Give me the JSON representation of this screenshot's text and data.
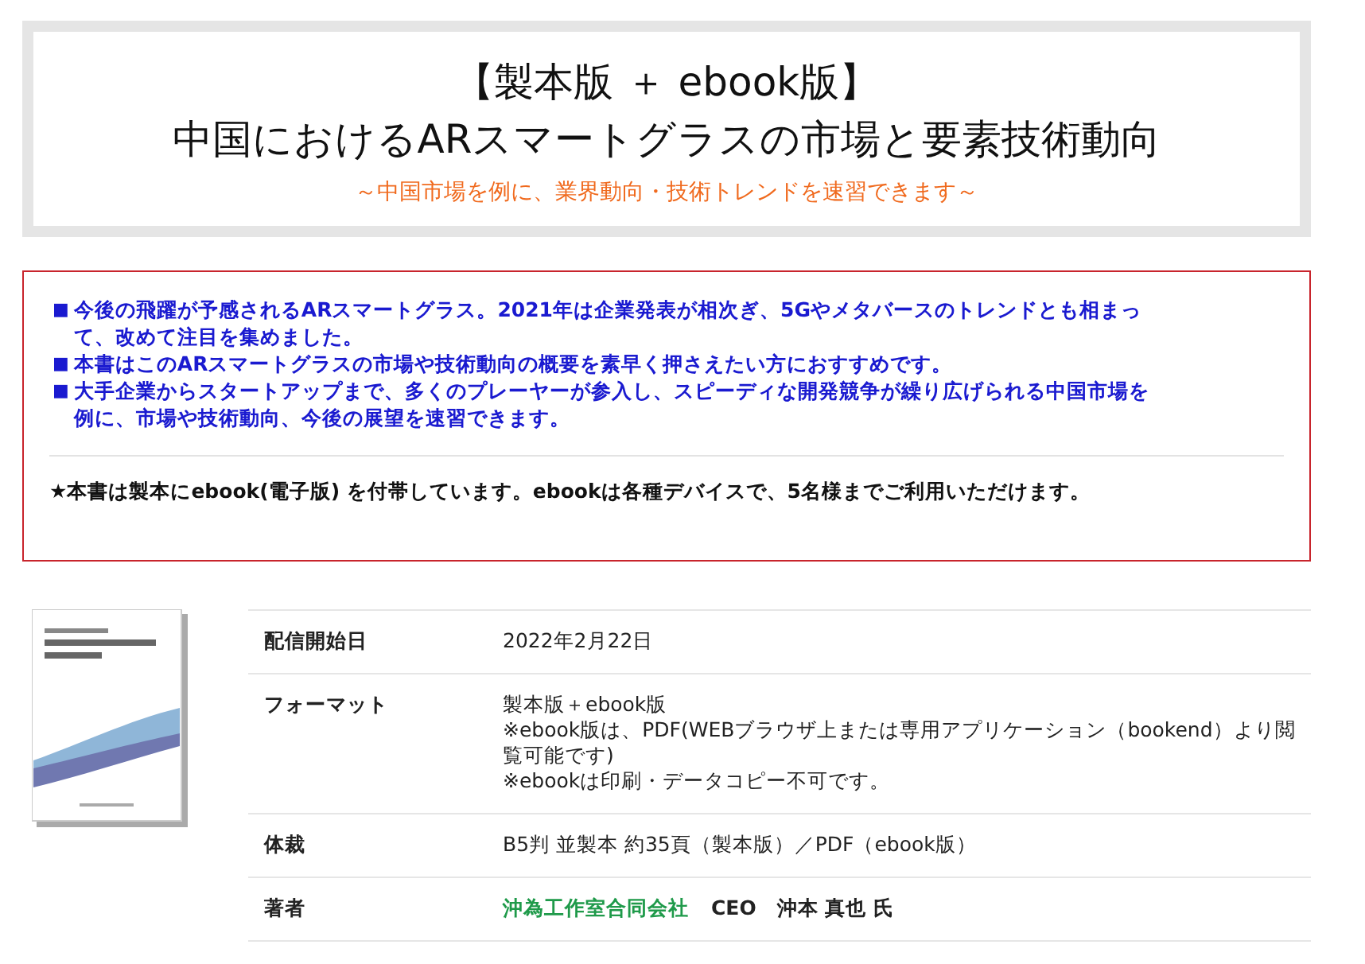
{
  "header": {
    "title_lines": [
      "【製本版 ＋ ebook版】",
      "中国におけるARスマートグラスの市場と要素技術動向"
    ],
    "subtitle": "～中国市場を例に、業界動向・技術トレンドを速習できます～"
  },
  "summary": {
    "bullets": [
      {
        "marker": "■",
        "text": "今後の飛躍が予感されるARスマートグラス。2021年は企業発表が相次ぎ、5Gやメタバースのトレンドとも相まって、改めて注目を集めました。"
      },
      {
        "marker": "■",
        "text": "本書はこのARスマートグラスの市場や技術動向の概要を素早く押さえたい方におすすめです。"
      },
      {
        "marker": "■",
        "text": "大手企業からスタートアップまで、多くのプレーヤーが参入し、スピーディな開発競争が繰り広げられる中国市場を例に、市場や技術動向、今後の展望を速習できます。"
      }
    ],
    "note": "★本書は製本にebook(電子版) を付帯しています。ebookは各種デバイスで、5名様までご利用いただけます。"
  },
  "details": [
    {
      "label": "配信開始日",
      "lines": [
        "2022年2月22日"
      ]
    },
    {
      "label": "フォーマット",
      "lines": [
        "製本版＋ebook版",
        "※ebook版は、PDF(WEBブラウザ上または専用アプリケーション（bookend）より閲覧可能です)",
        "※ebookは印刷・データコピー不可です。"
      ]
    },
    {
      "label": "体裁",
      "lines": [
        "B5判 並製本 約35頁（製本版）／PDF（ebook版）"
      ]
    },
    {
      "label": "著者",
      "kind": "author",
      "company": "沖為工作室合同会社",
      "person": "CEO　沖本 真也 氏"
    }
  ]
}
